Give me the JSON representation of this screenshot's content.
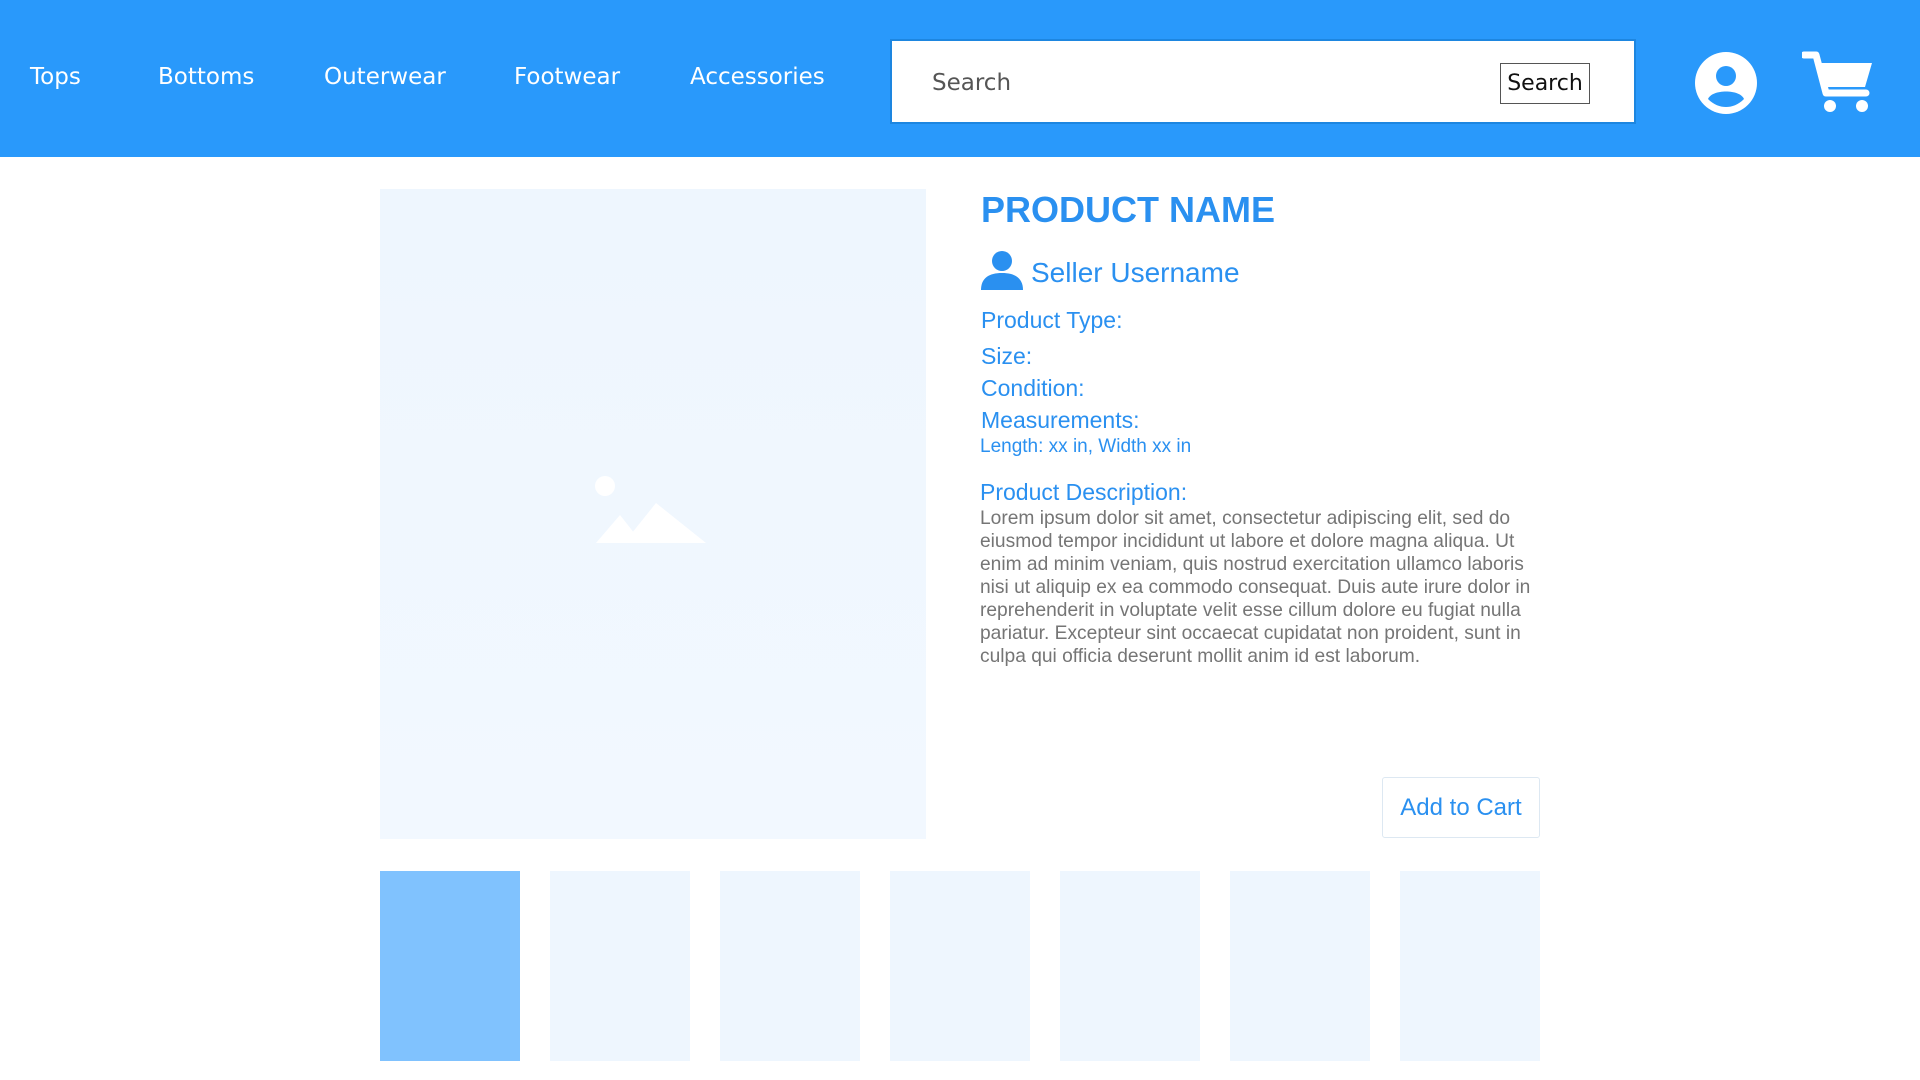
{
  "nav": {
    "links": [
      "Tops",
      "Bottoms",
      "Outerwear",
      "Footwear",
      "Accessories"
    ],
    "search": {
      "placeholder": "Search",
      "button_label": "Search"
    },
    "icons": {
      "account": "account-circle-icon",
      "cart": "shopping-cart-icon"
    }
  },
  "colors": {
    "navbar": "#2999fb",
    "accent": "#2a90f0",
    "body_text": "#757575",
    "image_placeholder": "#eef6fe",
    "thumbnail_active": "#80c2fe"
  },
  "product": {
    "name": "PRODUCT NAME",
    "seller": "Seller Username",
    "type_label": "Product Type:",
    "size_label": "Size:",
    "condition_label": "Condition:",
    "measurements_label": "Measurements:",
    "measurements_value": "Length: xx in, Width xx in",
    "description_label": "Product Description:",
    "description": "Lorem ipsum dolor sit amet, consectetur adipiscing elit, sed do eiusmod tempor incididunt ut labore et dolore magna aliqua. Ut enim ad minim veniam, quis nostrud exercitation ullamco laboris nisi ut aliquip ex ea commodo consequat. Duis aute irure dolor in reprehenderit in voluptate velit esse cillum dolore eu fugiat nulla pariatur. Excepteur sint occaecat cupidatat non proident, sunt in culpa qui officia deserunt mollit anim id est laborum.",
    "add_to_cart_label": "Add to Cart"
  },
  "thumbnails": {
    "count": 7,
    "selected_index": 0
  }
}
